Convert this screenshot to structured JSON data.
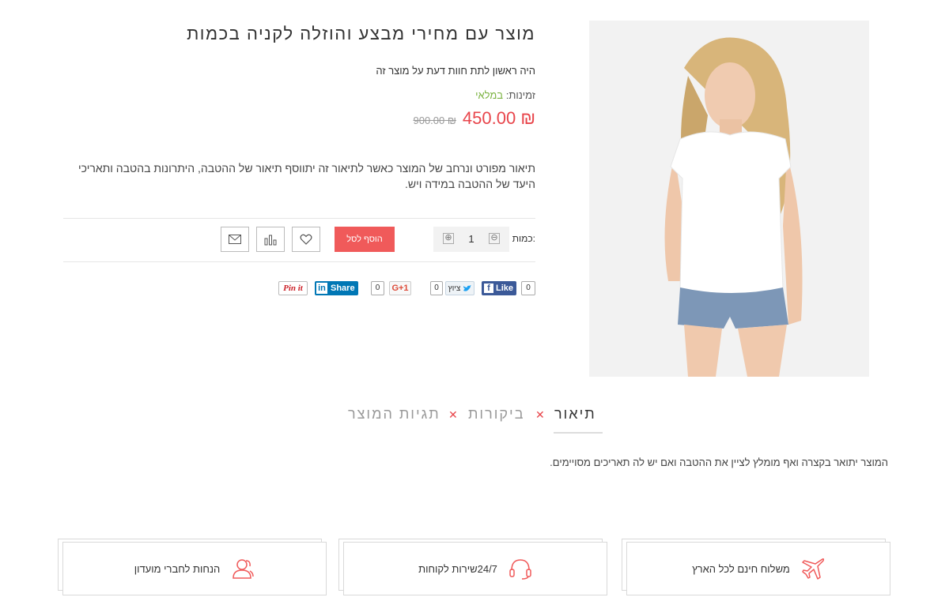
{
  "product": {
    "title": "מוצר עם מחירי מבצע והוזלה לקניה בכמות",
    "review_link": "היה ראשון לתת חוות דעת על מוצר זה",
    "availability_label": "זמינות:",
    "availability_value": "במלאי",
    "price_new": "₪ 450.00",
    "price_old": "₪ 900.00",
    "description": "תיאור מפורט ונרחב של המוצר כאשר לתיאור זה יתווסף תיאור של ההטבה, היתרונות בהטבה ותאריכי היעד של ההטבה במידה ויש.",
    "image_alt": "product-photo"
  },
  "actions": {
    "quantity_label": "כמות:",
    "quantity_value": "1",
    "minus_symbol": "⊖",
    "plus_symbol": "⊕",
    "add_to_cart": "הוסף לסל",
    "wishlist_icon": "heart-icon",
    "compare_icon": "bar-chart-icon",
    "email_icon": "envelope-icon"
  },
  "social": {
    "facebook_label": "Like",
    "facebook_count": "0",
    "twitter_label": "ציוץ",
    "twitter_count": "0",
    "gplus_label": "G+1",
    "gplus_count": "0",
    "linkedin_label": "Share",
    "pinterest_label": "Pin it"
  },
  "tabs": {
    "description": "תיאור",
    "reviews": "ביקורות",
    "tags": "תגיות המוצר",
    "content": "המוצר יתואר בקצרה ואף מומלץ לציין את ההטבה ואם יש לה תאריכים מסויימים."
  },
  "features": [
    {
      "label": "משלוח חינם לכל הארץ",
      "icon": "airplane-icon"
    },
    {
      "label": "24/7שירות לקוחות",
      "icon": "headset-icon"
    },
    {
      "label": "הנחות לחברי מועדון",
      "icon": "users-icon"
    }
  ],
  "colors": {
    "accent": "#f05a5a",
    "price": "#e8454b",
    "in_stock": "#7cb342",
    "facebook": "#3b5998",
    "linkedin": "#0077b5",
    "pinterest": "#cb2027"
  }
}
